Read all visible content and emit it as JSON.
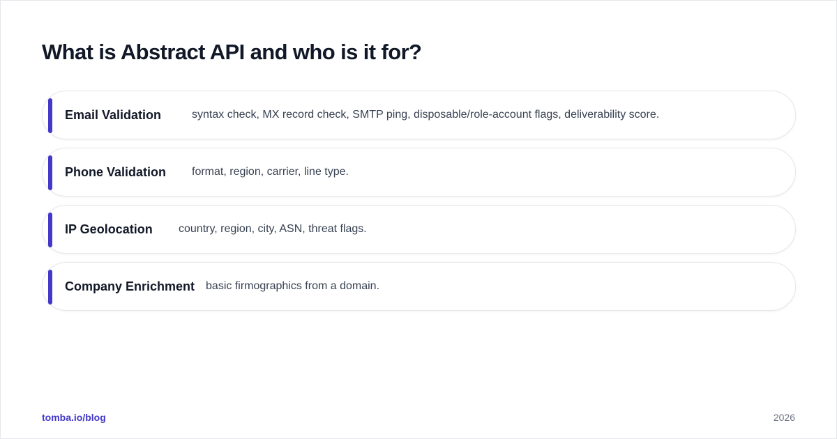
{
  "page": {
    "title": "What is Abstract API and who is it for?"
  },
  "items": [
    {
      "label": "Email Validation",
      "description": "syntax check, MX record check, SMTP ping, disposable/role-account flags, deliverability score."
    },
    {
      "label": "Phone Validation",
      "description": "format, region, carrier, line type."
    },
    {
      "label": "IP Geolocation",
      "description": "country, region, city, ASN, threat flags."
    },
    {
      "label": "Company Enrichment",
      "description": "basic firmographics from a domain."
    }
  ],
  "footer": {
    "source": "tomba.io/blog",
    "year": "2026"
  },
  "colors": {
    "accent": "#4338ca",
    "title": "#111827",
    "body_text": "#374151",
    "muted": "#6b7280",
    "border": "#e5e7eb"
  }
}
